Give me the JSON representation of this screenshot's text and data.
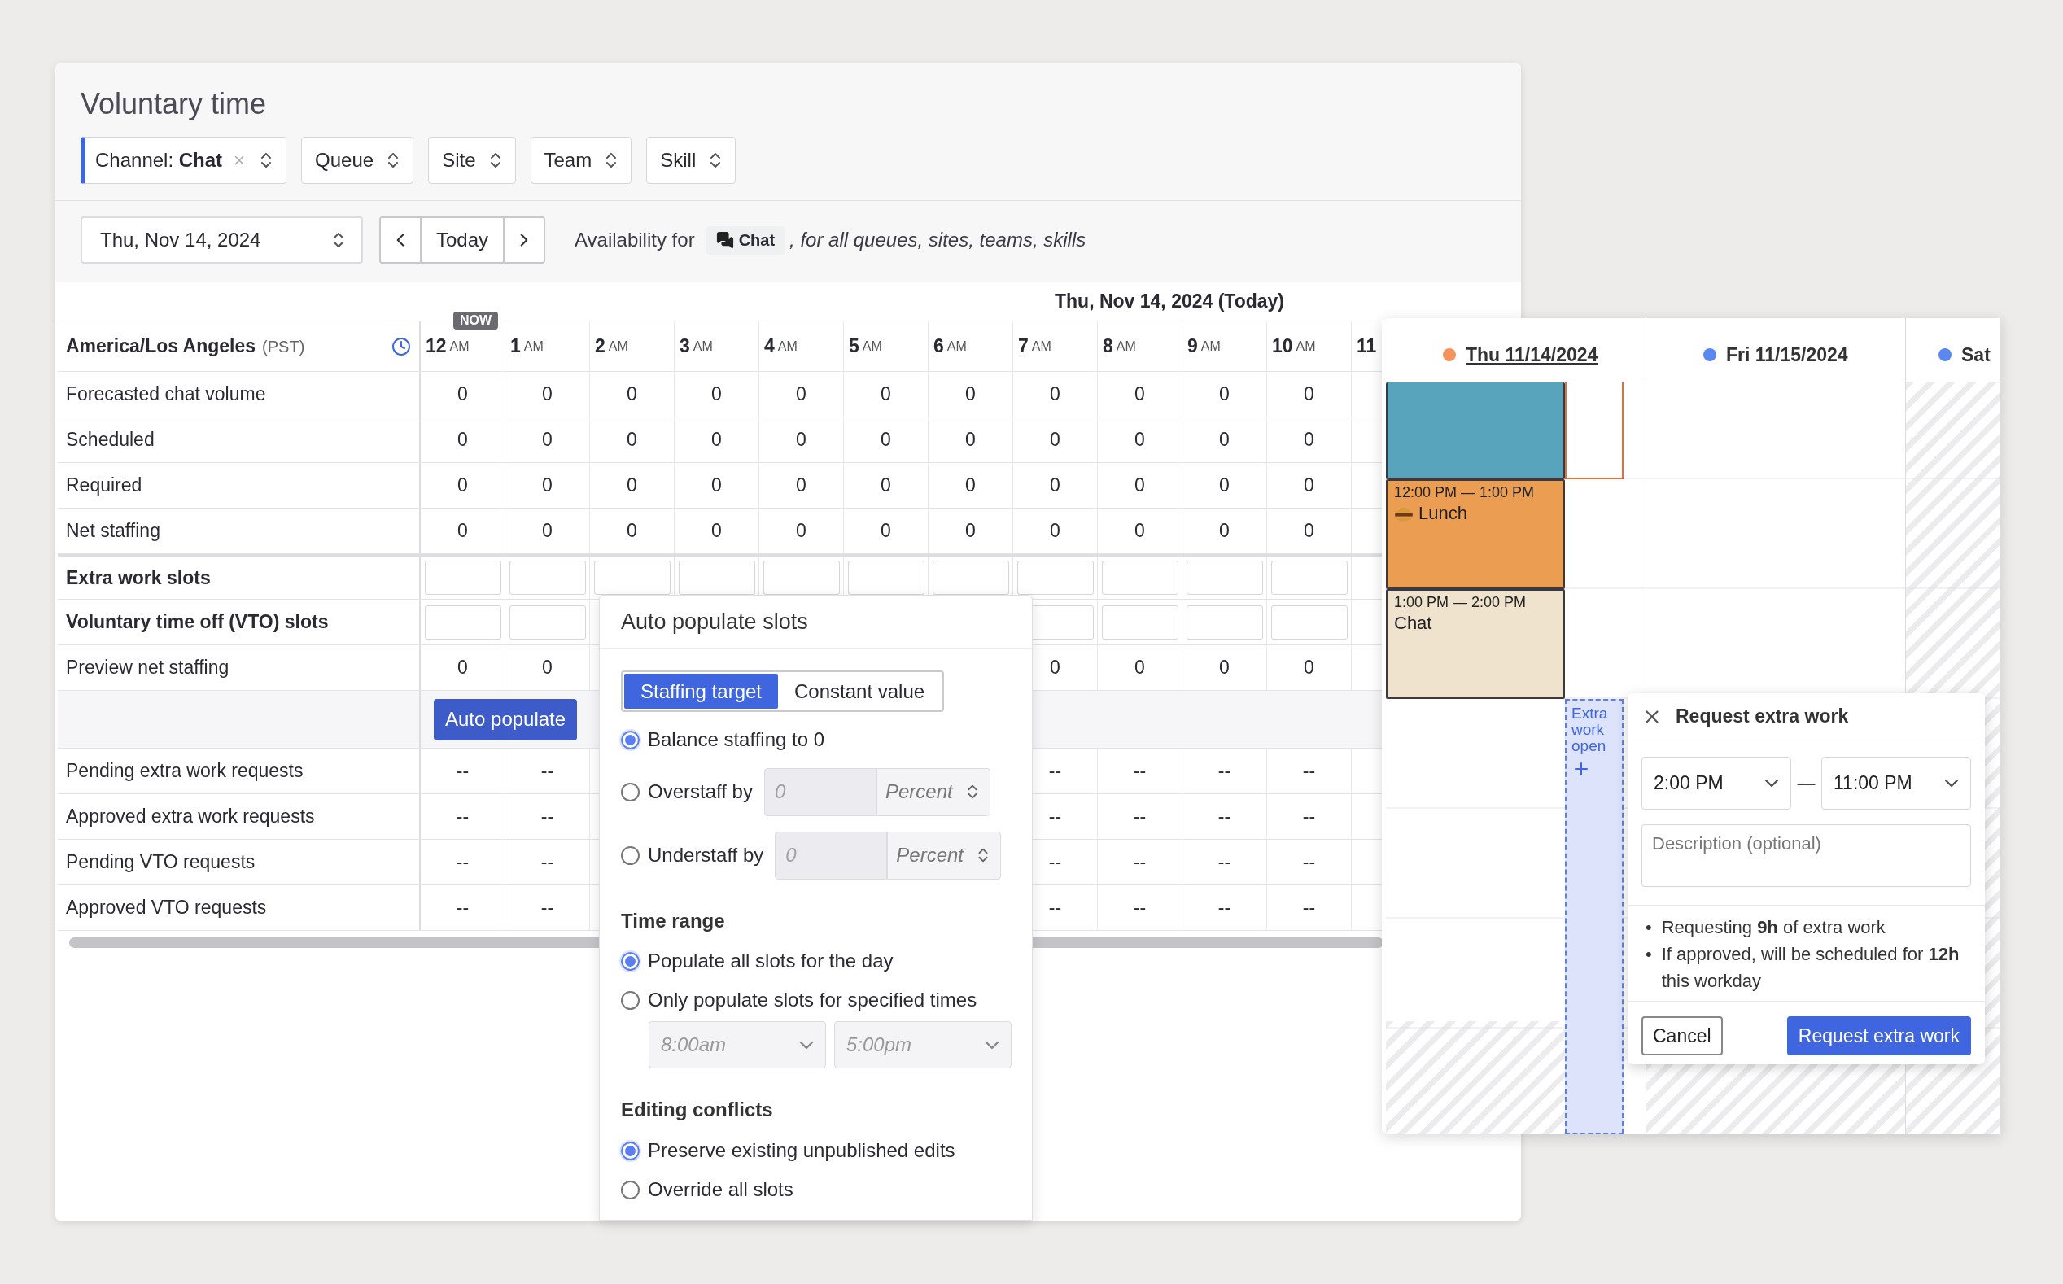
{
  "title": "Voluntary time",
  "filters": [
    {
      "label": "Channel: **Chat**",
      "active": true
    },
    {
      "label": "Queue",
      "active": false
    },
    {
      "label": "Site",
      "active": false
    },
    {
      "label": "Team",
      "active": false
    },
    {
      "label": "Skill",
      "active": false
    }
  ],
  "date_select": {
    "value": "Thu, Nov 14, 2024"
  },
  "nav": {
    "today": "Today"
  },
  "availability": {
    "prefix": "Availability for",
    "channel": "Chat",
    "suffix": ", for all queues, sites, teams, skills"
  },
  "grid": {
    "date_heading": "Thu, Nov 14, 2024 (Today)",
    "timezone": "America/Los Angeles",
    "timezone_abbr": "(PST)",
    "hours": [
      {
        "hour": "12",
        "period": "AM",
        "now_badge": "NOW"
      },
      {
        "hour": "1",
        "period": "AM"
      },
      {
        "hour": "2",
        "period": "AM"
      },
      {
        "hour": "3",
        "period": "AM"
      },
      {
        "hour": "4",
        "period": "AM"
      },
      {
        "hour": "5",
        "period": "AM"
      },
      {
        "hour": "6",
        "period": "AM"
      },
      {
        "hour": "7",
        "period": "AM"
      },
      {
        "hour": "8",
        "period": "AM"
      },
      {
        "hour": "9",
        "period": "AM"
      },
      {
        "hour": "10",
        "period": "AM"
      },
      {
        "hour": "11"
      }
    ],
    "rows": [
      {
        "kind": "values",
        "label": "Forecasted chat volume",
        "values": [
          "0",
          "0",
          "0",
          "0",
          "0",
          "0",
          "0",
          "0",
          "0",
          "0",
          "0"
        ]
      },
      {
        "kind": "values",
        "label": "Scheduled",
        "values": [
          "0",
          "0",
          "0",
          "0",
          "0",
          "0",
          "0",
          "0",
          "0",
          "0",
          "0"
        ]
      },
      {
        "kind": "values",
        "label": "Required",
        "values": [
          "0",
          "0",
          "0",
          "0",
          "0",
          "0",
          "0",
          "0",
          "0",
          "0",
          "0"
        ]
      },
      {
        "kind": "values",
        "label": "Net staffing",
        "values": [
          "0",
          "0",
          "0",
          "0",
          "0",
          "0",
          "0",
          "0",
          "0",
          "0",
          "0"
        ]
      },
      {
        "kind": "slots",
        "label": "Extra work slots"
      },
      {
        "kind": "slots",
        "label": "Voluntary time off (VTO) slots"
      },
      {
        "kind": "values",
        "label": "Preview net staffing",
        "values": [
          "0",
          "0",
          "0",
          "0",
          "0",
          "0"
        ]
      },
      {
        "kind": "action",
        "button": "Auto populate"
      },
      {
        "kind": "values",
        "label": "Pending extra work requests",
        "values": [
          "--",
          "--",
          "--",
          "--",
          "--",
          "--"
        ]
      },
      {
        "kind": "values",
        "label": "Approved extra work requests",
        "values": [
          "--",
          "--",
          "--",
          "--",
          "--",
          "--"
        ]
      },
      {
        "kind": "values",
        "label": "Pending VTO requests",
        "values": [
          "--",
          "--",
          "--",
          "--",
          "--",
          "--"
        ]
      },
      {
        "kind": "values",
        "label": "Approved VTO requests",
        "values": [
          "--",
          "--",
          "--",
          "--",
          "--",
          "--"
        ]
      }
    ]
  },
  "auto_populate": {
    "title": "Auto populate slots",
    "modes": [
      {
        "label": "Staffing target",
        "selected": true
      },
      {
        "label": "Constant value",
        "selected": false
      }
    ],
    "target_options": [
      {
        "kind": "plain",
        "label": "Balance staffing to 0",
        "selected": true
      },
      {
        "kind": "amount",
        "label": "Overstaff by",
        "selected": false,
        "amount_placeholder": "0",
        "unit": "Percent",
        "disabled": true
      },
      {
        "kind": "amount",
        "label": "Understaff by",
        "selected": false,
        "amount_placeholder": "0",
        "unit": "Percent",
        "disabled": true
      }
    ],
    "time_range": {
      "heading": "Time range",
      "options": [
        {
          "label": "Populate all slots for the day",
          "selected": true
        },
        {
          "label": "Only populate slots for specified times",
          "selected": false
        }
      ],
      "start": "8:00am",
      "end": "5:00pm",
      "disabled": true
    },
    "conflicts": {
      "heading": "Editing conflicts",
      "options": [
        {
          "label": "Preserve existing unpublished edits",
          "selected": true
        },
        {
          "label": "Override all slots",
          "selected": false
        }
      ]
    }
  },
  "calendar": {
    "days": [
      {
        "label": "Thu 11/14/2024",
        "color": "#f5935a",
        "selected": true,
        "unavailable": false
      },
      {
        "label": "Fri 11/15/2024",
        "color": "#5b87f0",
        "selected": false,
        "unavailable": false
      },
      {
        "label": "Sat",
        "color": "#5b87f0",
        "selected": false,
        "unavailable": true
      }
    ],
    "events": [
      {
        "kind": "shift",
        "color": "#58a4bd"
      },
      {
        "kind": "break",
        "time": "12:00 PM — 1:00 PM",
        "title": "Lunch",
        "color": "#eb9e52"
      },
      {
        "kind": "activity",
        "time": "1:00 PM — 2:00 PM",
        "title": "Chat",
        "color": "#f0e3cd"
      }
    ],
    "extra_work": {
      "label": "Extra work open"
    },
    "request": {
      "title": "Request extra work",
      "start": "2:00 PM",
      "separator": "—",
      "end": "11:00 PM",
      "description_placeholder": "Description (optional)",
      "notes": [
        {
          "marker": "•",
          "text": "Requesting **9h** of extra work"
        },
        {
          "marker": "•",
          "text": "If approved, will be scheduled for **12h** this workday"
        }
      ],
      "cancel": "Cancel",
      "submit": "Request extra work"
    }
  }
}
